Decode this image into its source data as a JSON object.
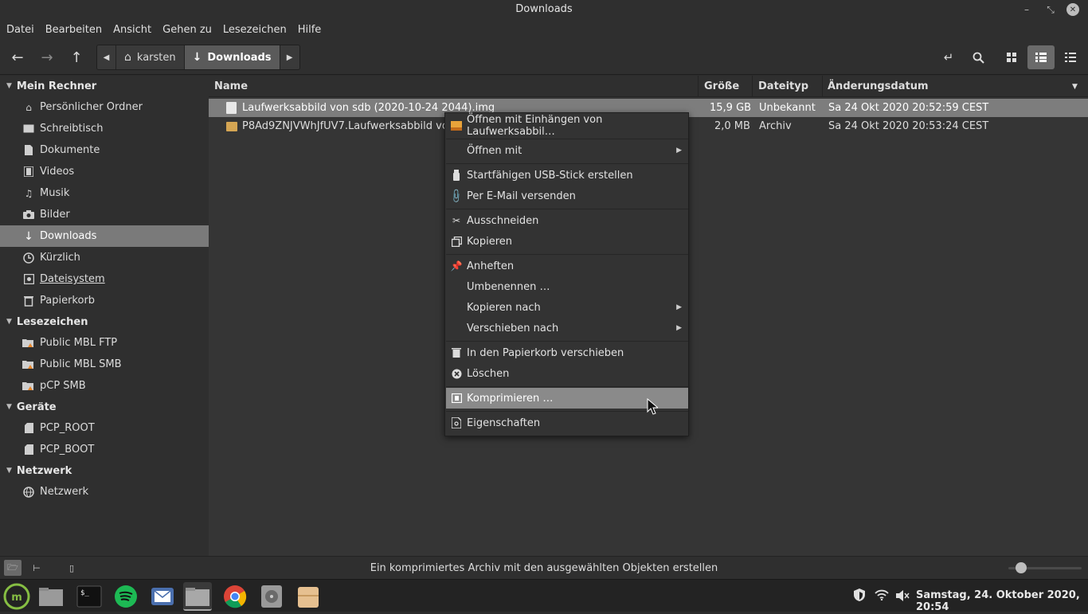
{
  "window": {
    "title": "Downloads"
  },
  "menubar": {
    "items": [
      "Datei",
      "Bearbeiten",
      "Ansicht",
      "Gehen zu",
      "Lesezeichen",
      "Hilfe"
    ]
  },
  "breadcrumb": {
    "home": "karsten",
    "current": "Downloads"
  },
  "sidebar": {
    "sections": [
      {
        "title": "Mein Rechner",
        "items": [
          {
            "label": "Persönlicher Ordner",
            "icon": "home-icon"
          },
          {
            "label": "Schreibtisch",
            "icon": "desktop-icon"
          },
          {
            "label": "Dokumente",
            "icon": "document-icon"
          },
          {
            "label": "Videos",
            "icon": "video-icon"
          },
          {
            "label": "Musik",
            "icon": "music-icon"
          },
          {
            "label": "Bilder",
            "icon": "camera-icon"
          },
          {
            "label": "Downloads",
            "icon": "download-icon",
            "selected": true
          },
          {
            "label": "Kürzlich",
            "icon": "clock-icon"
          },
          {
            "label": "Dateisystem",
            "icon": "disk-icon"
          },
          {
            "label": "Papierkorb",
            "icon": "trash-icon"
          }
        ]
      },
      {
        "title": "Lesezeichen",
        "items": [
          {
            "label": "Public MBL FTP",
            "icon": "network-folder-icon"
          },
          {
            "label": "Public MBL SMB",
            "icon": "network-folder-icon"
          },
          {
            "label": "pCP SMB",
            "icon": "network-folder-icon"
          }
        ]
      },
      {
        "title": "Geräte",
        "items": [
          {
            "label": "PCP_ROOT",
            "icon": "sdcard-icon"
          },
          {
            "label": "PCP_BOOT",
            "icon": "sdcard-icon"
          }
        ]
      },
      {
        "title": "Netzwerk",
        "items": [
          {
            "label": "Netzwerk",
            "icon": "network-icon"
          }
        ]
      }
    ]
  },
  "filelist": {
    "columns": [
      "Name",
      "Größe",
      "Dateityp",
      "Änderungsdatum"
    ],
    "rows": [
      {
        "name": "Laufwerksabbild von sdb (2020-10-24 2044).img",
        "size": "15,9 GB",
        "type": "Unbekannt",
        "date": "Sa 24 Okt 2020 20:52:59 CEST",
        "selected": true
      },
      {
        "name": "P8Ad9ZNJVWhJfUV7.Laufwerksabbild vo",
        "size": "2,0 MB",
        "type": "Archiv",
        "date": "Sa 24 Okt 2020 20:53:24 CEST",
        "selected": false
      }
    ]
  },
  "context_menu": {
    "items": [
      {
        "label": "Öffnen mit Einhängen von Laufwerksabbil…",
        "icon": "disk-image-icon"
      },
      {
        "label": "Öffnen mit",
        "submenu": true
      },
      {
        "label": "Startfähigen USB-Stick erstellen",
        "icon": "usb-icon"
      },
      {
        "label": "Per E-Mail versenden",
        "icon": "paperclip-icon"
      },
      {
        "label": "Ausschneiden",
        "icon": "scissors-icon"
      },
      {
        "label": "Kopieren",
        "icon": "copy-icon"
      },
      {
        "label": "Anheften",
        "icon": "pin-icon"
      },
      {
        "label": "Umbenennen …"
      },
      {
        "label": "Kopieren nach",
        "submenu": true
      },
      {
        "label": "Verschieben nach",
        "submenu": true
      },
      {
        "label": "In den Papierkorb verschieben",
        "icon": "trash-icon"
      },
      {
        "label": "Löschen",
        "icon": "delete-icon"
      },
      {
        "label": "Komprimieren …",
        "icon": "compress-icon",
        "highlighted": true
      },
      {
        "label": "Eigenschaften",
        "icon": "properties-icon"
      }
    ]
  },
  "statusbar": {
    "message": "Ein komprimiertes Archiv mit den ausgewählten Objekten erstellen"
  },
  "taskbar": {
    "clock": "Samstag, 24. Oktober 2020, 20:54"
  },
  "colors": {
    "accent": "#7d7d7d",
    "mint_green": "#86be43",
    "spotify_green": "#1db954"
  }
}
